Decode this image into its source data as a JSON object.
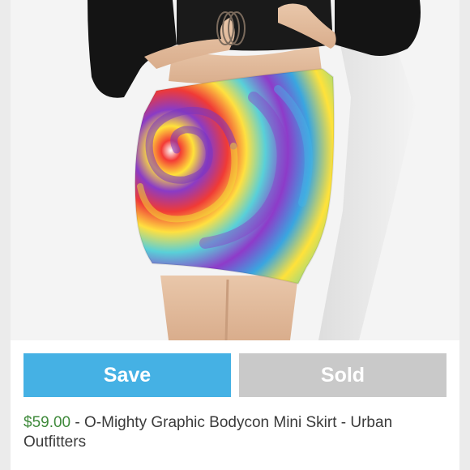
{
  "actions": {
    "save_label": "Save",
    "sold_label": "Sold"
  },
  "listing": {
    "price": "$59.00",
    "separator": " - ",
    "title": "O-Mighty Graphic Bodycon Mini Skirt - Urban Outfitters"
  },
  "colors": {
    "save": "#45b1e4",
    "sold": "#c9c9c9",
    "price": "#3f8a3b"
  }
}
